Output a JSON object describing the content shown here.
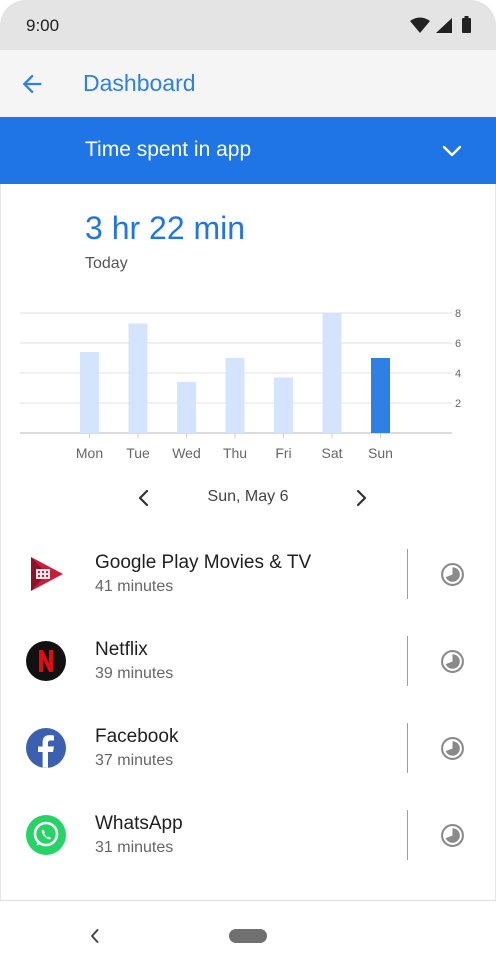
{
  "status_bar": {
    "time": "9:00",
    "icons": [
      "wifi-icon",
      "signal-icon",
      "battery-icon"
    ]
  },
  "app_bar": {
    "title": "Dashboard",
    "back_icon": "arrow-back-icon"
  },
  "selector": {
    "label": "Time spent in app",
    "icon": "chevron-down-icon"
  },
  "summary": {
    "total": "3 hr 22 min",
    "period": "Today"
  },
  "chart_data": {
    "type": "bar",
    "categories": [
      "Mon",
      "Tue",
      "Wed",
      "Thu",
      "Fri",
      "Sat",
      "Sun"
    ],
    "values": [
      5.4,
      7.3,
      3.4,
      5.0,
      3.7,
      8.0,
      5.0
    ],
    "highlighted_index": 6,
    "yticks": [
      "2",
      "4",
      "6",
      "8"
    ],
    "ylim": [
      0,
      8
    ],
    "grid": true,
    "colors": {
      "bar": "#d4e4fc",
      "highlight": "#2f80e4",
      "grid": "#e0e0e0"
    }
  },
  "date_nav": {
    "label": "Sun, May 6",
    "prev_icon": "chevron-left-icon",
    "next_icon": "chevron-right-icon"
  },
  "apps": [
    {
      "name": "Google Play Movies & TV",
      "time": "41 minutes",
      "icon": "google-play-movies-icon"
    },
    {
      "name": "Netflix",
      "time": "39 minutes",
      "icon": "netflix-icon"
    },
    {
      "name": "Facebook",
      "time": "37 minutes",
      "icon": "facebook-icon"
    },
    {
      "name": "WhatsApp",
      "time": "31 minutes",
      "icon": "whatsapp-icon"
    }
  ],
  "nav_bar": {
    "back_icon": "nav-back-icon",
    "home_icon": "home-pill-icon"
  }
}
